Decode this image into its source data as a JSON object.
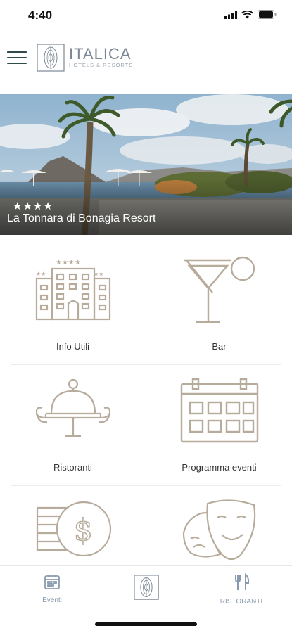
{
  "status_bar": {
    "time": "4:40"
  },
  "header": {
    "brand_name": "ITALICA",
    "brand_sub": "HOTELS & RESORTS"
  },
  "hero": {
    "stars": "★★★★",
    "title": "La Tonnara di Bonagia Resort"
  },
  "grid": {
    "items": [
      {
        "label": "Info Utili",
        "icon": "hotel-building-icon"
      },
      {
        "label": "Bar",
        "icon": "cocktail-glass-icon"
      },
      {
        "label": "Ristoranti",
        "icon": "cloche-icon"
      },
      {
        "label": "Programma eventi",
        "icon": "calendar-icon"
      },
      {
        "label": "",
        "icon": "coins-dollar-icon"
      },
      {
        "label": "",
        "icon": "theater-masks-icon"
      }
    ]
  },
  "bottom_nav": {
    "items": [
      {
        "label": "Eventi",
        "icon": "calendar-icon"
      },
      {
        "label": "",
        "icon": "italica-logo-icon"
      },
      {
        "label": "RISTORANTI",
        "icon": "fork-knife-icon"
      }
    ]
  },
  "colors": {
    "icon_stroke": "#b7ab9c",
    "nav_icon": "#8a9aae",
    "menu_icon": "#2e4a49"
  }
}
